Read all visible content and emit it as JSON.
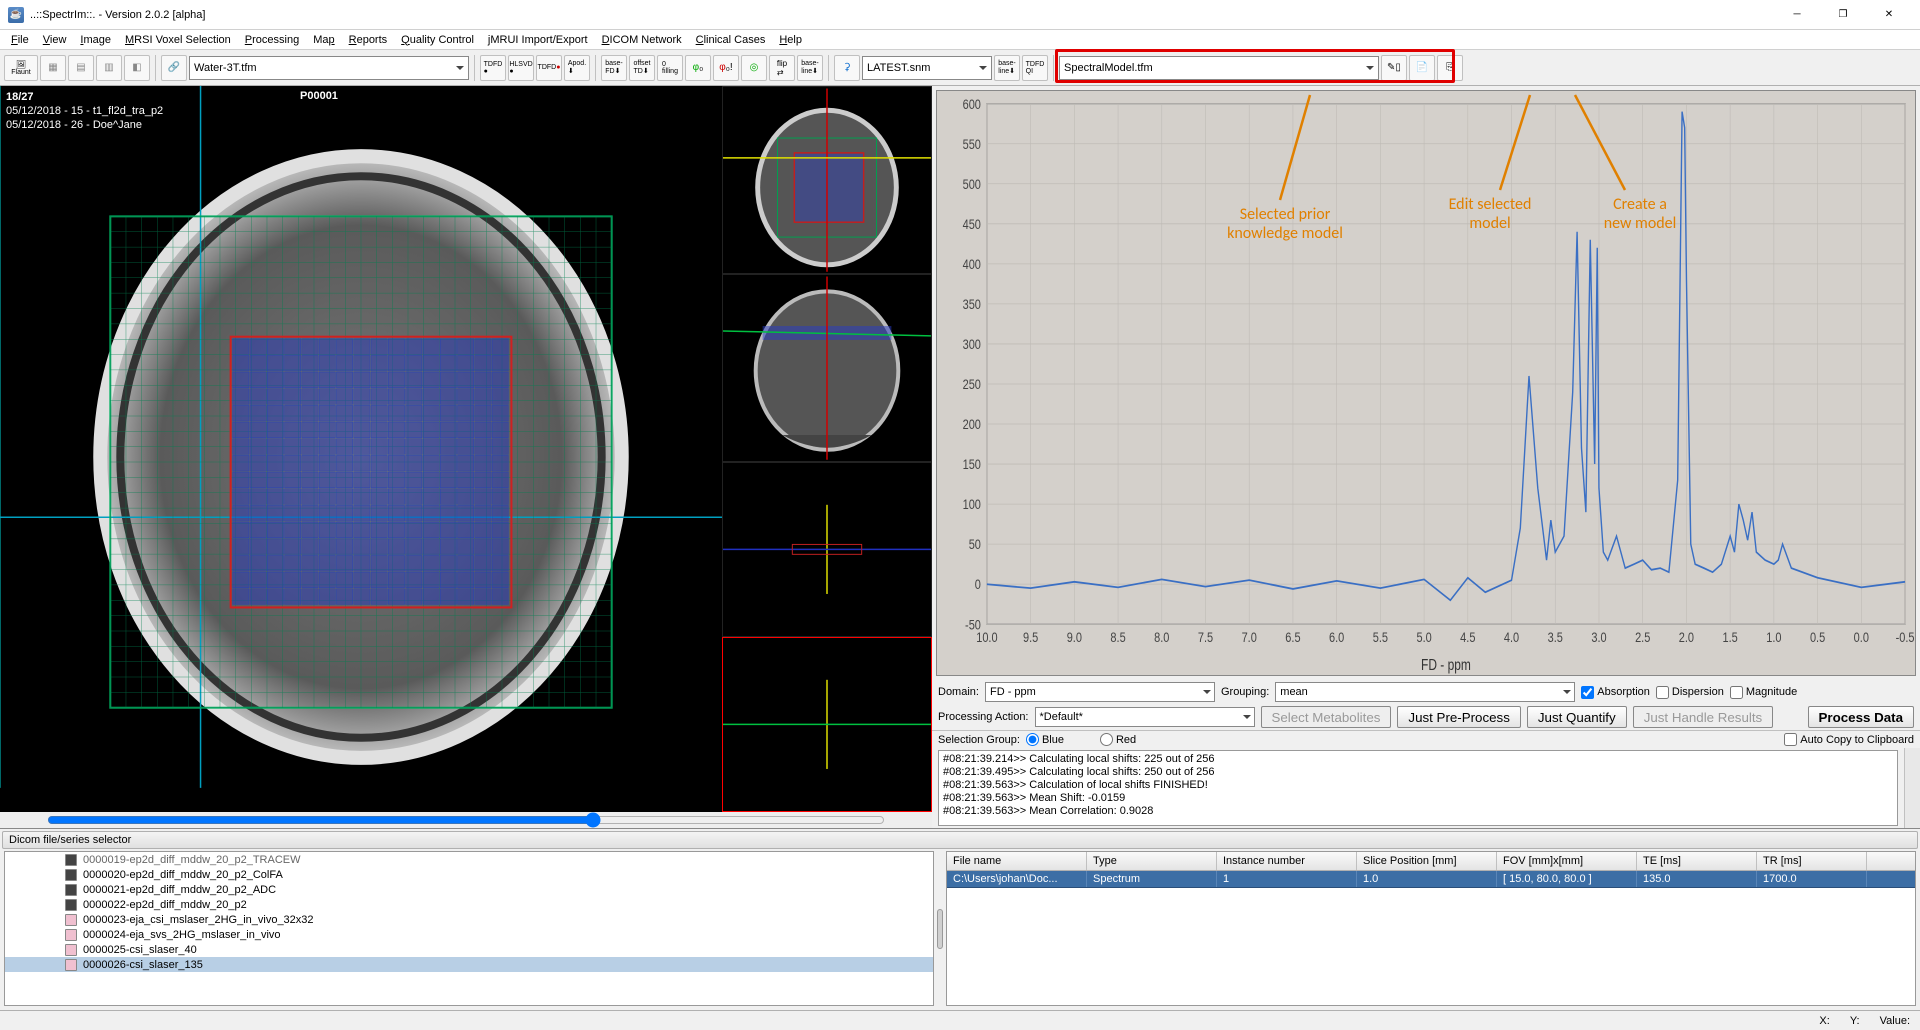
{
  "window": {
    "title": "..::SpectrIm::.   -   Version 2.0.2 [alpha]"
  },
  "menu": [
    "File",
    "View",
    "Image",
    "MRSI Voxel Selection",
    "Processing",
    "Map",
    "Reports",
    "Quality Control",
    "jMRUI Import/Export",
    "DICOM Network",
    "Clinical Cases",
    "Help"
  ],
  "toolbar": {
    "water_combo": "Water-3T.tfm",
    "latest_combo": "LATEST.snm",
    "model_combo": "SpectralModel.tfm"
  },
  "viewer": {
    "slice": "18/27",
    "series_line1": "05/12/2018 - 15 - t1_fl2d_tra_p2",
    "series_line2": "05/12/2018 - 26 - Doe^Jane",
    "patient": "P00001"
  },
  "right": {
    "domain_label": "Domain:",
    "domain_value": "FD - ppm",
    "grouping_label": "Grouping:",
    "grouping_value": "mean",
    "absorption": "Absorption",
    "dispersion": "Dispersion",
    "magnitude": "Magnitude",
    "proc_action_label": "Processing Action:",
    "proc_action_value": "*Default*",
    "btn_select_metab": "Select Metabolites",
    "btn_preprocess": "Just Pre-Process",
    "btn_quantify": "Just Quantify",
    "btn_handle": "Just Handle Results",
    "btn_process": "Process Data",
    "sel_group_label": "Selection Group:",
    "sel_blue": "Blue",
    "sel_red": "Red",
    "auto_copy": "Auto Copy to Clipboard",
    "log": [
      "#08:21:39.214>> Calculating local shifts: 225 out of 256",
      "#08:21:39.495>> Calculating local shifts: 250 out of 256",
      "#08:21:39.563>> Calculation of local shifts FINISHED!",
      "#08:21:39.563>> Mean Shift: -0.0159",
      "#08:21:39.563>> Mean Correlation: 0.9028"
    ]
  },
  "dicom": {
    "title": "Dicom file/series selector",
    "series": [
      {
        "icon": "d",
        "name": "0000019-ep2d_diff_mddw_20_p2_TRACEW",
        "cut": true
      },
      {
        "icon": "d",
        "name": "0000020-ep2d_diff_mddw_20_p2_ColFA"
      },
      {
        "icon": "d",
        "name": "0000021-ep2d_diff_mddw_20_p2_ADC"
      },
      {
        "icon": "d",
        "name": "0000022-ep2d_diff_mddw_20_p2"
      },
      {
        "icon": "p",
        "name": "0000023-eja_csi_mslaser_2HG_in_vivo_32x32"
      },
      {
        "icon": "p",
        "name": "0000024-eja_svs_2HG_mslaser_in_vivo"
      },
      {
        "icon": "p",
        "name": "0000025-csi_slaser_40"
      },
      {
        "icon": "p",
        "name": "0000026-csi_slaser_135",
        "sel": true
      }
    ],
    "table": {
      "headers": [
        "File name",
        "Type",
        "Instance number",
        "Slice Position [mm]",
        "FOV [mm]x[mm]",
        "TE [ms]",
        "TR [ms]"
      ],
      "row": [
        "C:\\Users\\johan\\Doc...",
        "Spectrum",
        "1",
        "1.0",
        "[ 15.0, 80.0, 80.0 ]",
        "135.0",
        "1700.0"
      ]
    }
  },
  "status": {
    "x": "X:",
    "y": "Y:",
    "value": "Value:"
  },
  "annotations": {
    "a1": "Selected prior\nknowledge model",
    "a2": "Edit selected\nmodel",
    "a3": "Create a\nnew model"
  },
  "chart_data": {
    "type": "line",
    "title": "",
    "xlabel": "FD - ppm",
    "ylabel": "",
    "xlim": [
      10.0,
      -0.5
    ],
    "ylim": [
      -50,
      600
    ],
    "xticks": [
      10.0,
      9.5,
      9.0,
      8.5,
      8.0,
      7.5,
      7.0,
      6.5,
      6.0,
      5.5,
      5.0,
      4.5,
      4.0,
      3.5,
      3.0,
      2.5,
      2.0,
      1.5,
      1.0,
      0.5,
      0.0,
      -0.5
    ],
    "yticks": [
      -50,
      0,
      50,
      100,
      150,
      200,
      250,
      300,
      350,
      400,
      450,
      500,
      550,
      600
    ],
    "series": [
      {
        "name": "spectrum",
        "color": "#3a6fc4",
        "x": [
          10.0,
          9.5,
          9.0,
          8.5,
          8.0,
          7.5,
          7.0,
          6.5,
          6.0,
          5.5,
          5.0,
          4.7,
          4.5,
          4.3,
          4.0,
          3.9,
          3.8,
          3.7,
          3.6,
          3.55,
          3.5,
          3.4,
          3.3,
          3.25,
          3.2,
          3.15,
          3.1,
          3.05,
          3.02,
          3.0,
          2.95,
          2.9,
          2.8,
          2.7,
          2.6,
          2.5,
          2.4,
          2.3,
          2.2,
          2.1,
          2.05,
          2.02,
          2.0,
          1.95,
          1.9,
          1.8,
          1.7,
          1.6,
          1.5,
          1.45,
          1.4,
          1.35,
          1.3,
          1.25,
          1.2,
          1.1,
          1.0,
          0.95,
          0.9,
          0.8,
          0.5,
          0.0,
          -0.5
        ],
        "y": [
          0,
          -5,
          3,
          -4,
          6,
          -3,
          5,
          -6,
          4,
          -5,
          6,
          -20,
          8,
          -10,
          5,
          70,
          260,
          120,
          30,
          80,
          40,
          60,
          240,
          440,
          170,
          90,
          430,
          150,
          420,
          120,
          40,
          30,
          60,
          20,
          25,
          30,
          18,
          20,
          15,
          130,
          590,
          570,
          380,
          50,
          25,
          20,
          15,
          25,
          60,
          40,
          100,
          80,
          55,
          90,
          40,
          30,
          25,
          30,
          50,
          20,
          8,
          -4,
          3
        ]
      }
    ]
  }
}
